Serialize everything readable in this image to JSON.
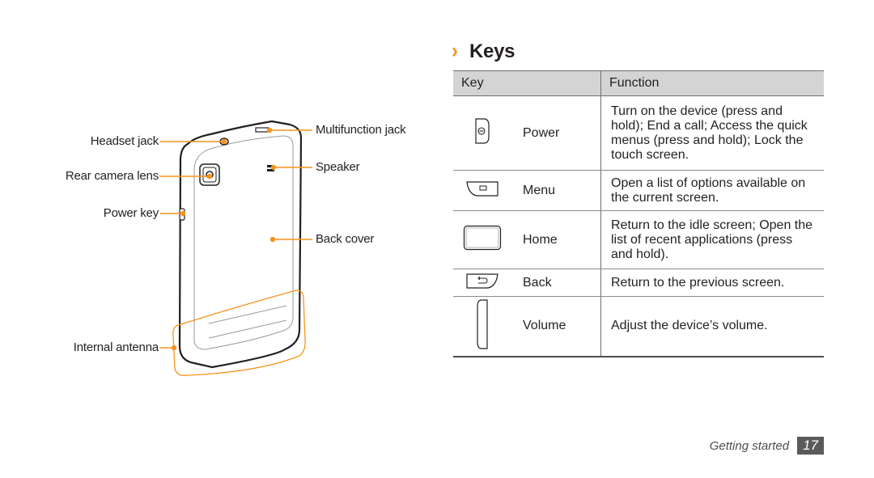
{
  "diagram": {
    "callouts": {
      "headset_jack": "Headset jack",
      "rear_camera_lens": "Rear camera lens",
      "power_key": "Power key",
      "internal_antenna": "Internal antenna",
      "multifunction_jack": "Multifunction jack",
      "speaker": "Speaker",
      "back_cover": "Back cover"
    },
    "accent_color": "#f7941d"
  },
  "section": {
    "chevron": "›",
    "title": "Keys"
  },
  "table": {
    "headers": {
      "key": "Key",
      "function": "Function"
    },
    "rows": [
      {
        "icon": "power-key-icon",
        "name": "Power",
        "function": "Turn on the device (press and hold); End a call; Access the quick menus (press and hold); Lock the touch screen."
      },
      {
        "icon": "menu-key-icon",
        "name": "Menu",
        "function": "Open a list of options available on the current screen."
      },
      {
        "icon": "home-key-icon",
        "name": "Home",
        "function": "Return to the idle screen; Open the list of recent applications (press and hold)."
      },
      {
        "icon": "back-key-icon",
        "name": "Back",
        "function": "Return to the previous screen."
      },
      {
        "icon": "volume-key-icon",
        "name": "Volume",
        "function": "Adjust the device’s volume."
      }
    ]
  },
  "footer": {
    "section_name": "Getting started",
    "page_number": "17"
  }
}
